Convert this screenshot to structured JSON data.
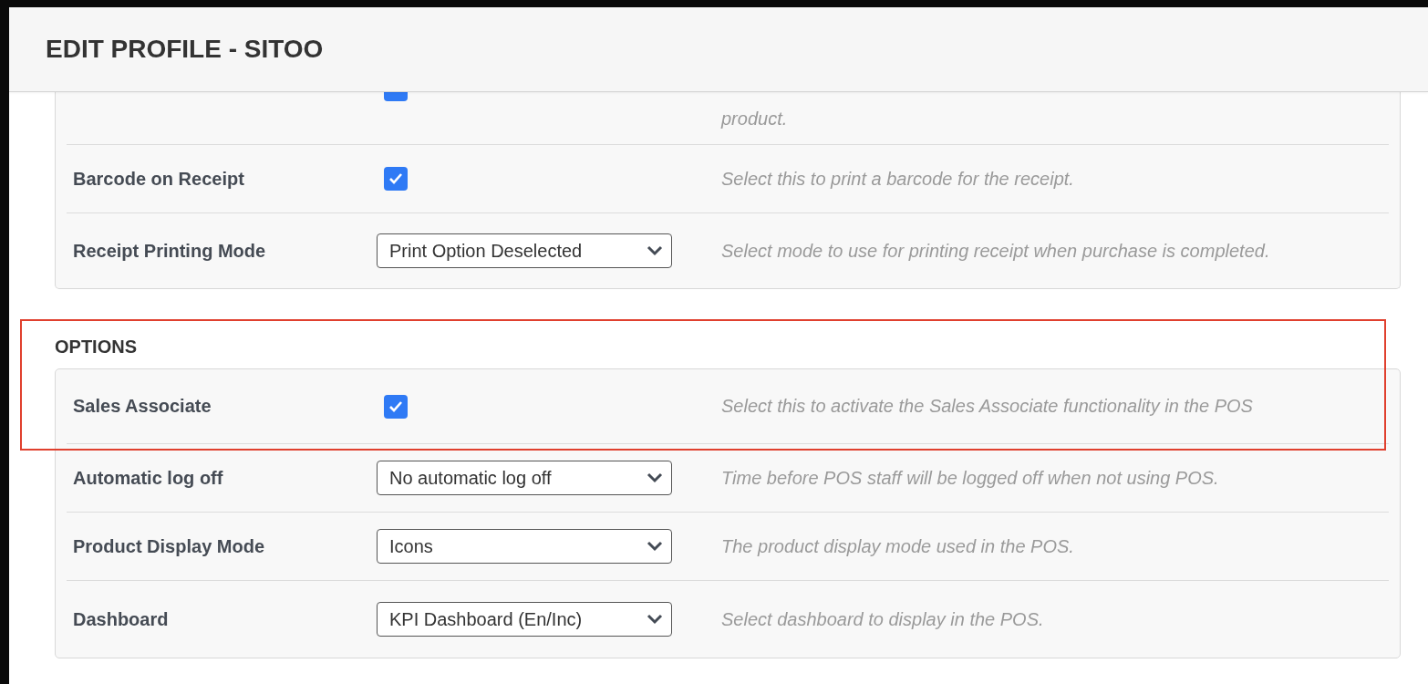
{
  "header": {
    "title": "EDIT PROFILE - SITOO"
  },
  "receipt_card": {
    "partial_row": {
      "kind": "checkbox",
      "checked": true,
      "description": "product."
    },
    "rows": [
      {
        "kind": "checkbox",
        "label": "Barcode on Receipt",
        "checked": true,
        "description": "Select this to print a barcode for the receipt."
      },
      {
        "kind": "select",
        "label": "Receipt Printing Mode",
        "value": "Print Option Deselected",
        "description": "Select mode to use for printing receipt when purchase is completed."
      }
    ]
  },
  "options": {
    "heading": "OPTIONS",
    "highlighted": true,
    "rows": [
      {
        "kind": "checkbox",
        "label": "Sales Associate",
        "checked": true,
        "description": "Select this to activate the Sales Associate functionality in the POS"
      },
      {
        "kind": "select",
        "label": "Automatic log off",
        "value": "No automatic log off",
        "description": "Time before POS staff will be logged off when not using POS."
      },
      {
        "kind": "select",
        "label": "Product Display Mode",
        "value": "Icons",
        "description": "The product display mode used in the POS."
      },
      {
        "kind": "select",
        "label": "Dashboard",
        "value": "KPI Dashboard (En/Inc)",
        "description": "Select dashboard to display in the POS."
      }
    ]
  }
}
